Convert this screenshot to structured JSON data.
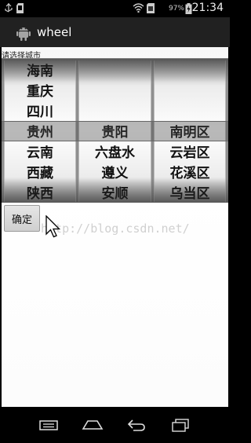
{
  "status_bar": {
    "battery_percent": "97%",
    "time": "21:34",
    "icons": [
      "usb-icon",
      "sd-card-icon",
      "wifi-icon",
      "sim-icon",
      "battery-charging-icon"
    ]
  },
  "action_bar": {
    "app_icon": "android-icon",
    "title": "wheel"
  },
  "prompt": "请选择城市",
  "wheels": {
    "province": [
      "海南",
      "重庆",
      "四川",
      "贵州",
      "云南",
      "西藏",
      "陕西"
    ],
    "city": [
      "",
      "",
      "",
      "贵阳",
      "六盘水",
      "遵义",
      "安顺"
    ],
    "district": [
      "",
      "",
      "",
      "南明区",
      "云岩区",
      "花溪区",
      "乌当区"
    ],
    "selected": {
      "province": "贵州",
      "city": "贵阳",
      "district": "南明区"
    }
  },
  "confirm_button": "确定",
  "watermark": "http://blog.csdn.net/",
  "nav_bar": {
    "icons": [
      "menu-icon",
      "home-icon",
      "back-icon",
      "recents-icon"
    ]
  },
  "colors": {
    "action_bar_bg": "#212121",
    "status_bar_bg": "#000000",
    "selection_band": "#555555"
  }
}
